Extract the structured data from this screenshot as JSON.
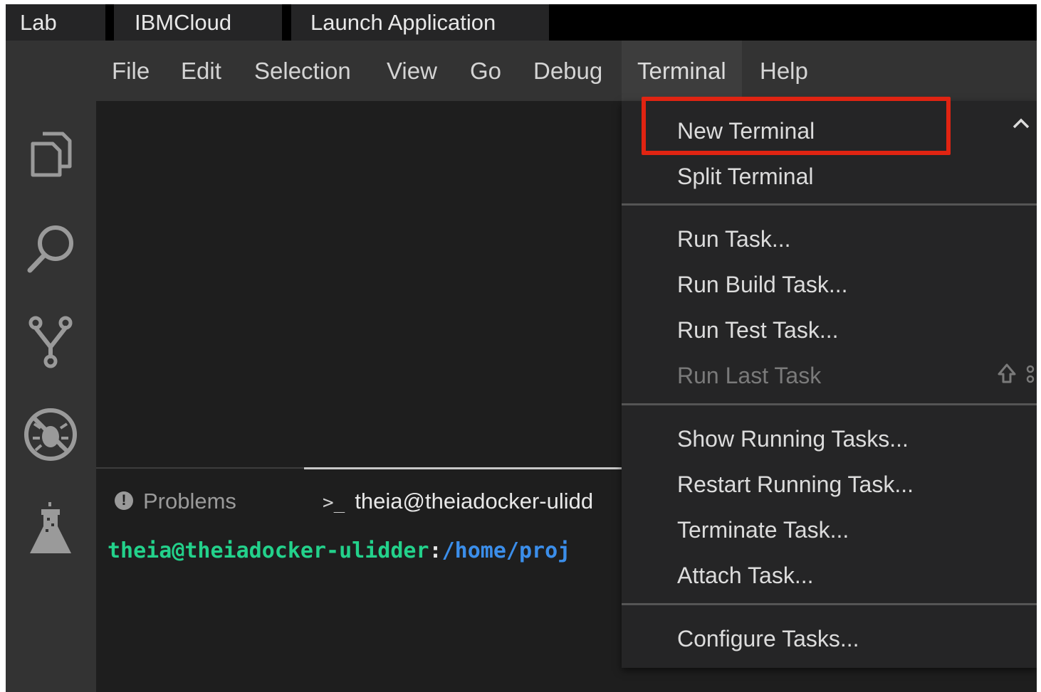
{
  "tabs": [
    "Lab",
    "IBMCloud",
    "Launch Application"
  ],
  "menubar": {
    "items": [
      "File",
      "Edit",
      "Selection",
      "View",
      "Go",
      "Debug",
      "Terminal",
      "Help"
    ],
    "active": "Terminal"
  },
  "activity_bar": {
    "icons": [
      "explorer-icon",
      "search-icon",
      "source-control-icon",
      "debug-icon",
      "test-flask-icon"
    ]
  },
  "panel": {
    "problems_label": "Problems",
    "problems_icon": "!",
    "terminal_prompt_symbol": ">_",
    "terminal_tab_label": "theia@theiadocker-ulidd",
    "prompt_user": "theia@theiadocker-ulidder",
    "prompt_colon": ":",
    "prompt_path": "/home/proj"
  },
  "terminal_menu": {
    "group1": [
      "New Terminal",
      "Split Terminal"
    ],
    "group2": [
      "Run Task...",
      "Run Build Task...",
      "Run Test Task...",
      "Run Last Task"
    ],
    "group3": [
      "Show Running Tasks...",
      "Restart Running Task...",
      "Terminate Task...",
      "Attach Task..."
    ],
    "group4": [
      "Configure Tasks..."
    ],
    "disabled_item": "Run Last Task",
    "highlighted_item": "New Terminal",
    "run_last_task_shortcut": "⇧"
  },
  "colors": {
    "highlight": "#e02412",
    "prompt_user": "#23d18b",
    "prompt_path": "#3b8eea"
  }
}
